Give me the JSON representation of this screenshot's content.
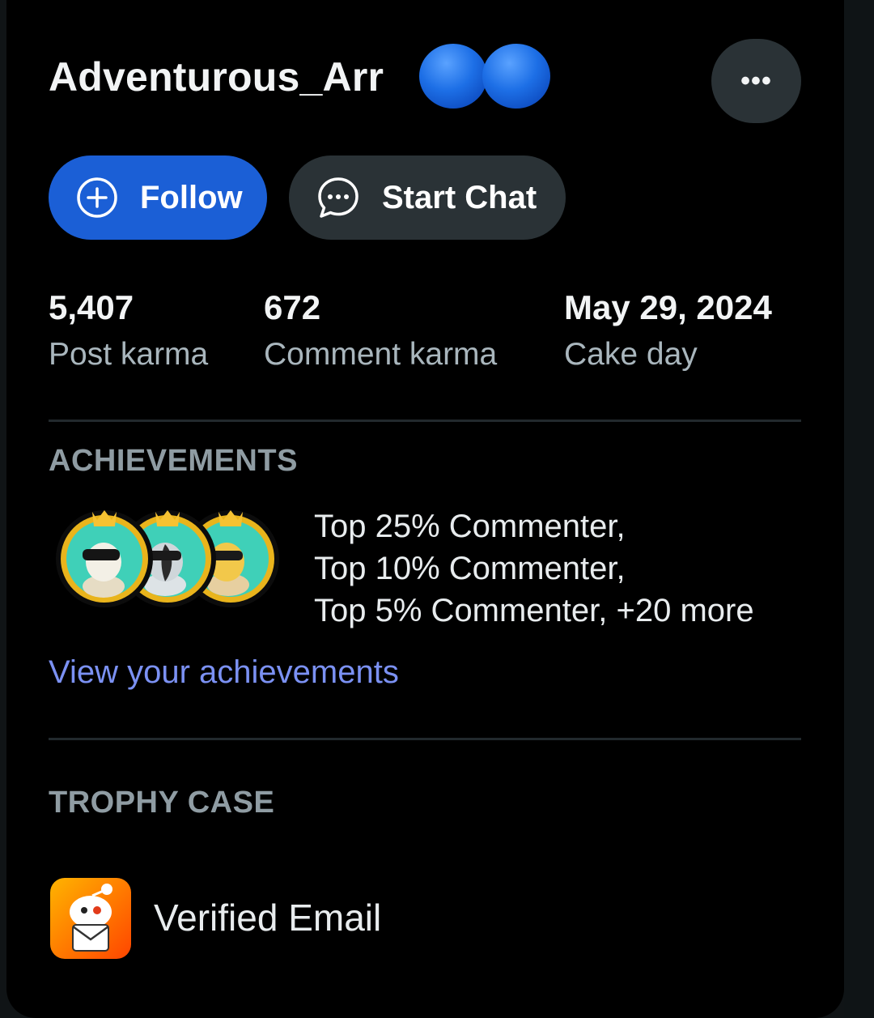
{
  "profile": {
    "username": "Adventurous_Arr",
    "more_label": "•••"
  },
  "actions": {
    "follow_label": "Follow",
    "chat_label": "Start Chat"
  },
  "stats": [
    {
      "value": "5,407",
      "label": "Post karma"
    },
    {
      "value": "672",
      "label": "Comment karma"
    },
    {
      "value": "May 29, 2024",
      "label": "Cake day"
    }
  ],
  "achievements": {
    "title": "ACHIEVEMENTS",
    "lines": [
      "Top 25% Commenter,",
      "Top 10% Commenter,",
      "Top 5% Commenter, +20 more"
    ],
    "link_label": "View your achievements"
  },
  "trophy_case": {
    "title": "TROPHY CASE",
    "items": [
      {
        "label": "Verified Email",
        "icon": "verified-email-trophy-icon"
      }
    ]
  },
  "colors": {
    "background": "#000000",
    "follow_button": "#1b5fd6",
    "secondary_button": "#2a3236",
    "link": "#7b91f3",
    "muted_text": "#a9b6bd",
    "section_title": "#8f9ca3"
  }
}
